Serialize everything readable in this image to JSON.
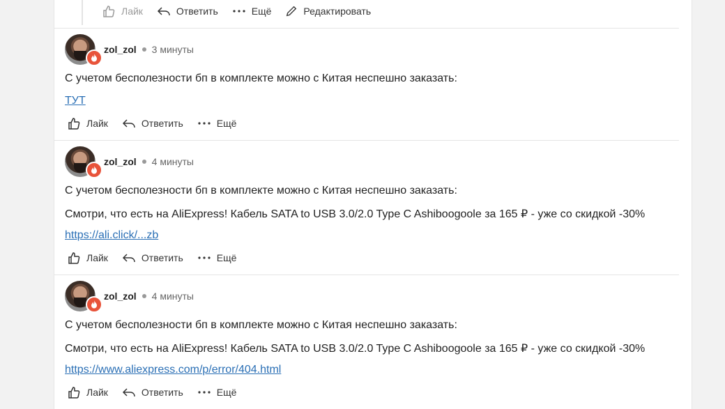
{
  "top_actions": {
    "like": "Лайк",
    "reply": "Ответить",
    "more": "Ещё",
    "edit": "Редактировать"
  },
  "comments": [
    {
      "username": "zol_zol",
      "time": "3 минуты",
      "lines": [
        "С учетом бесполезности бп в комплекте можно с Китая неспешно заказать:"
      ],
      "link": "ТУТ",
      "actions": {
        "like": "Лайк",
        "reply": "Ответить",
        "more": "Ещё"
      }
    },
    {
      "username": "zol_zol",
      "time": "4 минуты",
      "lines": [
        "С учетом бесполезности бп в комплекте можно с Китая неспешно заказать:",
        "Смотри, что есть на AliExpress! Кабель SATA to USB 3.0/2.0 Type C Ashiboogoole за 165 ₽ - уже со скидкой -30%"
      ],
      "link": "https://ali.click/...zb",
      "actions": {
        "like": "Лайк",
        "reply": "Ответить",
        "more": "Ещё"
      }
    },
    {
      "username": "zol_zol",
      "time": "4 минуты",
      "lines": [
        "С учетом бесполезности бп в комплекте можно с Китая неспешно заказать:",
        "Смотри, что есть на AliExpress! Кабель SATA to USB 3.0/2.0 Type C Ashiboogoole за 165 ₽ - уже со скидкой -30%"
      ],
      "link": "https://www.aliexpress.com/p/error/404.html",
      "actions": {
        "like": "Лайк",
        "reply": "Ответить",
        "more": "Ещё"
      }
    }
  ],
  "colors": {
    "link": "#2a6fb5",
    "badge": "#e8533a"
  },
  "icons": [
    "like-icon",
    "reply-icon",
    "more-icon",
    "edit-icon",
    "fire-badge-icon"
  ]
}
